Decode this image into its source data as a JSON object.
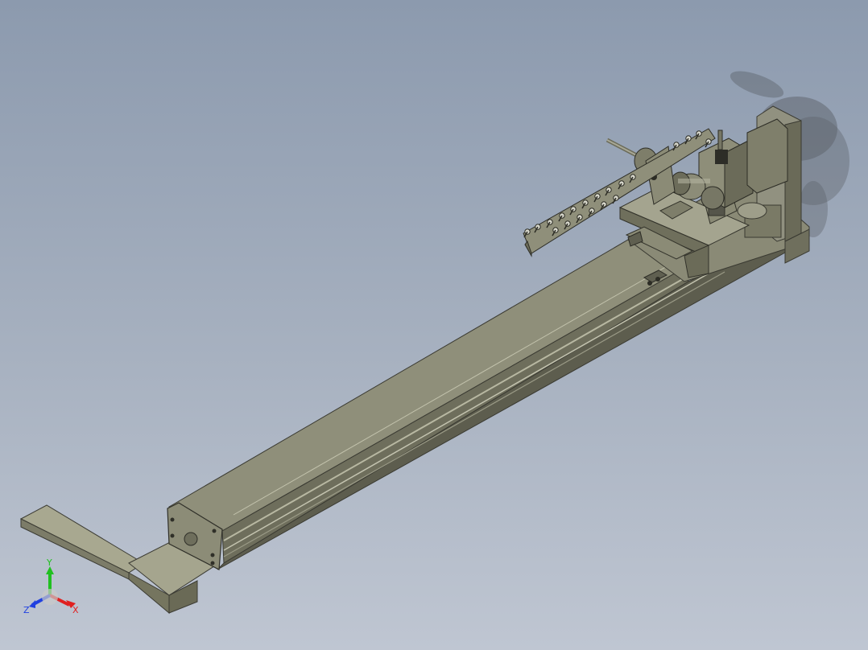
{
  "viewport": {
    "background_top": "#8c9aae",
    "background_bottom": "#bfc6d2"
  },
  "model": {
    "body_color": "#8e8e78",
    "dark_color": "#4a4a40",
    "rail_color": "#a9a994"
  },
  "triad": {
    "x_label": "X",
    "y_label": "Y",
    "z_label": "Z",
    "x_color": "#e02020",
    "y_color": "#20c020",
    "z_color": "#2040e0"
  }
}
